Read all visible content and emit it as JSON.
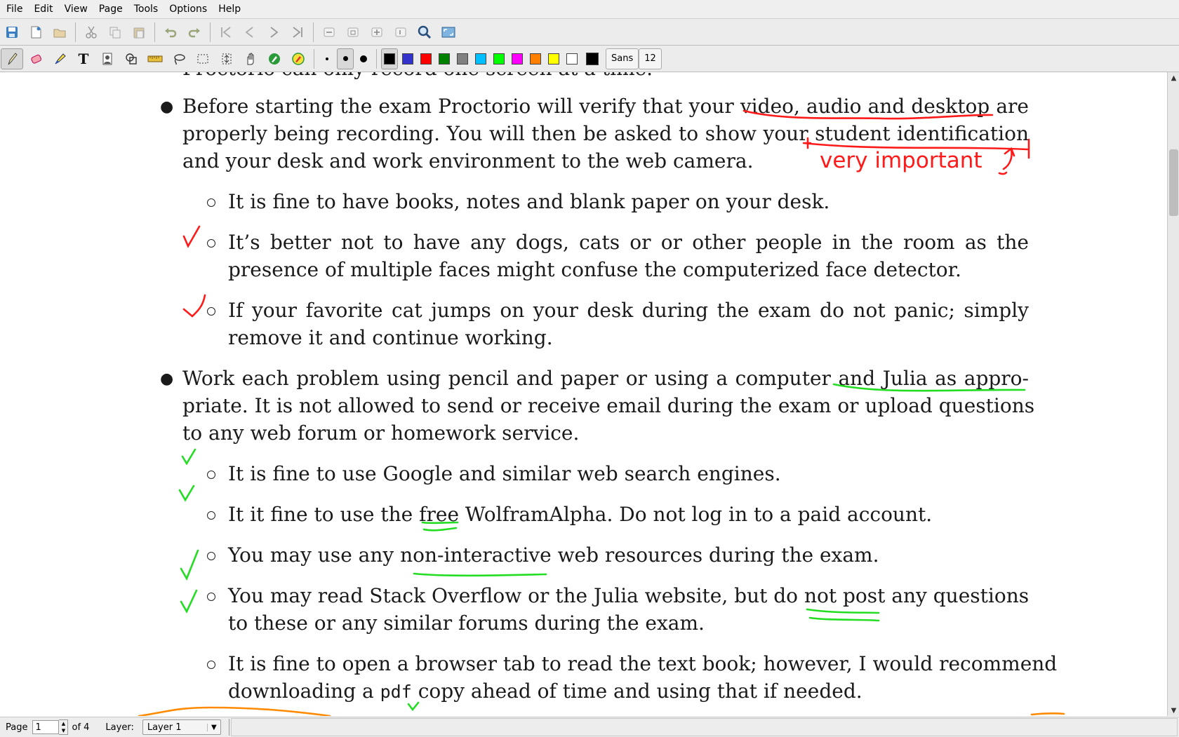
{
  "menu": [
    "File",
    "Edit",
    "View",
    "Page",
    "Tools",
    "Options",
    "Help"
  ],
  "toolbar_main": [
    {
      "icon": "save-icon"
    },
    {
      "icon": "new-page-icon"
    },
    {
      "icon": "open-icon"
    },
    {
      "icon": "cut-icon"
    },
    {
      "icon": "copy-icon"
    },
    {
      "icon": "paste-icon"
    },
    {
      "icon": "undo-icon"
    },
    {
      "icon": "redo-icon"
    },
    {
      "icon": "first-page-icon"
    },
    {
      "icon": "previous-page-icon"
    },
    {
      "icon": "next-page-icon"
    },
    {
      "icon": "last-page-icon"
    },
    {
      "icon": "zoom-out-icon"
    },
    {
      "icon": "zoom-fit-icon"
    },
    {
      "icon": "zoom-in-icon"
    },
    {
      "icon": "zoom-reset-icon"
    },
    {
      "icon": "zoom-search-icon"
    },
    {
      "icon": "fullscreen-icon"
    }
  ],
  "toolbar_tools": {
    "tools": [
      "pen-icon",
      "eraser-icon",
      "highlighter-icon",
      "text-icon",
      "image-icon",
      "shape-recognizer-icon",
      "ruler-icon",
      "lasso-select-icon",
      "rect-select-icon",
      "vertical-space-icon",
      "hand-icon",
      "default-pen-icon",
      "default-highlighter-icon"
    ],
    "thickness": [
      "fine",
      "medium",
      "thick"
    ],
    "colors": [
      "#000000",
      "#3333cc",
      "#ff0000",
      "#008000",
      "#808080",
      "#00c0ff",
      "#00ff00",
      "#ff00ff",
      "#ff8000",
      "#ffff00",
      "#ffffff",
      "#000000"
    ],
    "font_name": "Sans",
    "font_size": "12"
  },
  "document": {
    "top_line": "Proctorio can only record one screen at a time.",
    "p1_l1": "Before starting the exam Proctorio will verify that your video, audio and desktop are",
    "p1_l2": "properly being recording. You will then be asked to show your student identification",
    "p1_l3": "and your desk and work environment to the web camera.",
    "s1": "It is fine to have books, notes and blank paper on your desk.",
    "s2_l1": "It’s better not to have any dogs, cats or or other people in the room as the",
    "s2_l2": "presence of multiple faces might confuse the computerized face detector.",
    "s3_l1": "If your favorite cat jumps on your desk during the exam do not panic; simply",
    "s3_l2": "remove it and continue working.",
    "p2_l1": "Work each problem using pencil and paper or using a computer and Julia as appro-",
    "p2_l2": "priate. It is not allowed to send or receive email during the exam or upload questions",
    "p2_l3": "to any web forum or homework service.",
    "s4": "It is fine to use Google and similar web search engines.",
    "s5": "It it fine to use the free WolframAlpha. Do not log in to a paid account.",
    "s6": "You may use any non-interactive web resources during the exam.",
    "s7_l1": "You may read Stack Overflow or the Julia website, but do not post any questions",
    "s7_l2": "to these or any similar forums during the exam.",
    "s8_l1": "It is fine to open a browser tab to read the text book; however, I would recommend",
    "s8_l2_a": "downloading a",
    "s8_l2_code": "pdf",
    "s8_l2_b": "copy ahead of time and using that if needed."
  },
  "annotations": {
    "note": "very important",
    "red": "#ff0000",
    "green": "#22dd22",
    "orange": "#ff8a00"
  },
  "status": {
    "page_label": "Page",
    "page_value": "1",
    "of_pages": "of 4",
    "layer_label": "Layer:",
    "layer_value": "Layer 1"
  }
}
